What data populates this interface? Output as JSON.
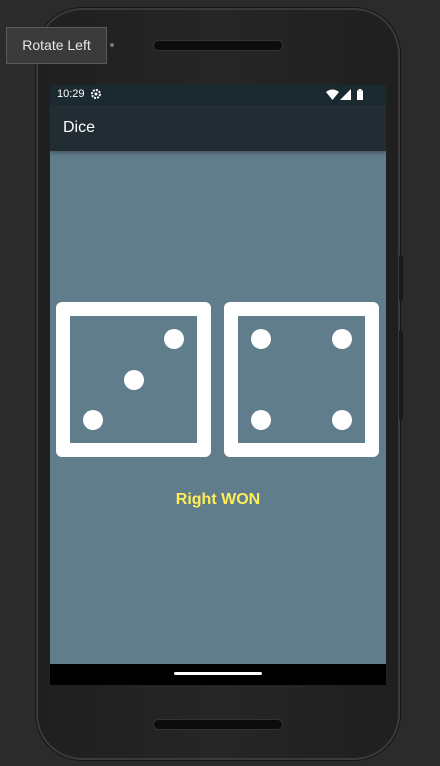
{
  "tooltip": {
    "label": "Rotate Left"
  },
  "status_bar": {
    "time": "10:29",
    "icons": [
      "gear-icon",
      "wifi-icon",
      "signal-icon",
      "battery-icon"
    ]
  },
  "app_bar": {
    "title": "Dice"
  },
  "dice": {
    "left_value": 3,
    "right_value": 4
  },
  "result": {
    "text": "Right WON"
  },
  "colors": {
    "screen_background": "#607d8b",
    "app_bar": "#212c33",
    "status_bar": "#1b2a31",
    "die_color": "#ffffff",
    "result_text": "#ffee58",
    "nav_bar": "#000000"
  }
}
